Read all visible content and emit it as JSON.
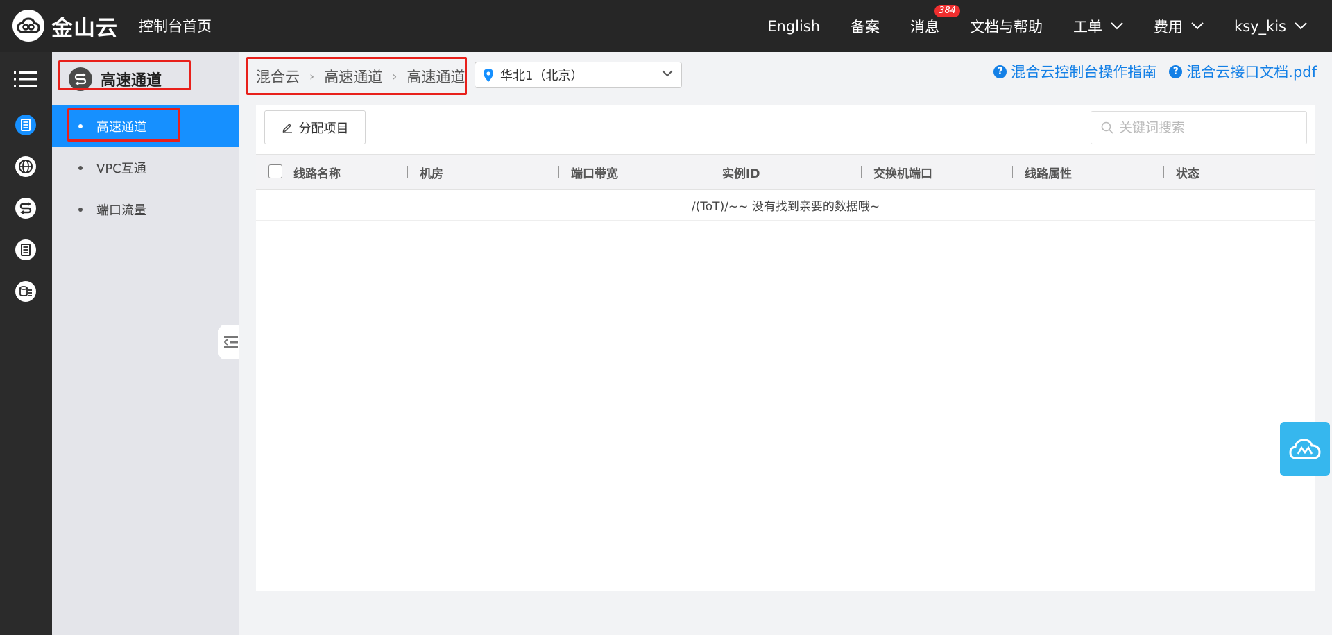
{
  "topbar": {
    "logo_text": "金山云",
    "console_home": "控制台首页",
    "nav": {
      "english": "English",
      "beian": "备案",
      "messages": "消息",
      "messages_badge": "384",
      "docs": "文档与帮助",
      "ticket": "工单",
      "billing": "费用",
      "user": "ksy_kis"
    }
  },
  "rail": {
    "icons": [
      "menu-icon",
      "server-icon",
      "globe-icon",
      "channel-icon",
      "list-icon",
      "database-icon"
    ],
    "active_index": 1,
    "accent": "#1690ff"
  },
  "submenu": {
    "title": "高速通道",
    "items": [
      {
        "label": "高速通道",
        "active": true
      },
      {
        "label": "VPC互通",
        "active": false
      },
      {
        "label": "端口流量",
        "active": false
      }
    ]
  },
  "breadcrumb": [
    "混合云",
    "高速通道",
    "高速通道"
  ],
  "region": {
    "selected": "华北1（北京）"
  },
  "help_links": {
    "guide": "混合云控制台操作指南",
    "api_doc": "混合云接口文档.pdf"
  },
  "toolbar": {
    "assign_label": "分配项目",
    "search_placeholder": "关键词搜索"
  },
  "table": {
    "columns": [
      "线路名称",
      "机房",
      "端口带宽",
      "实例ID",
      "交换机端口",
      "线路属性",
      "状态"
    ],
    "rows": [],
    "empty_text": "/(ToT)/~~ 没有找到亲要的数据哦~"
  },
  "colors": {
    "topbar_bg": "#262626",
    "active_blue": "#1690ff",
    "link_blue": "#1480e6",
    "highlight_red": "#e8201b",
    "badge_red": "#ef2f2f"
  }
}
